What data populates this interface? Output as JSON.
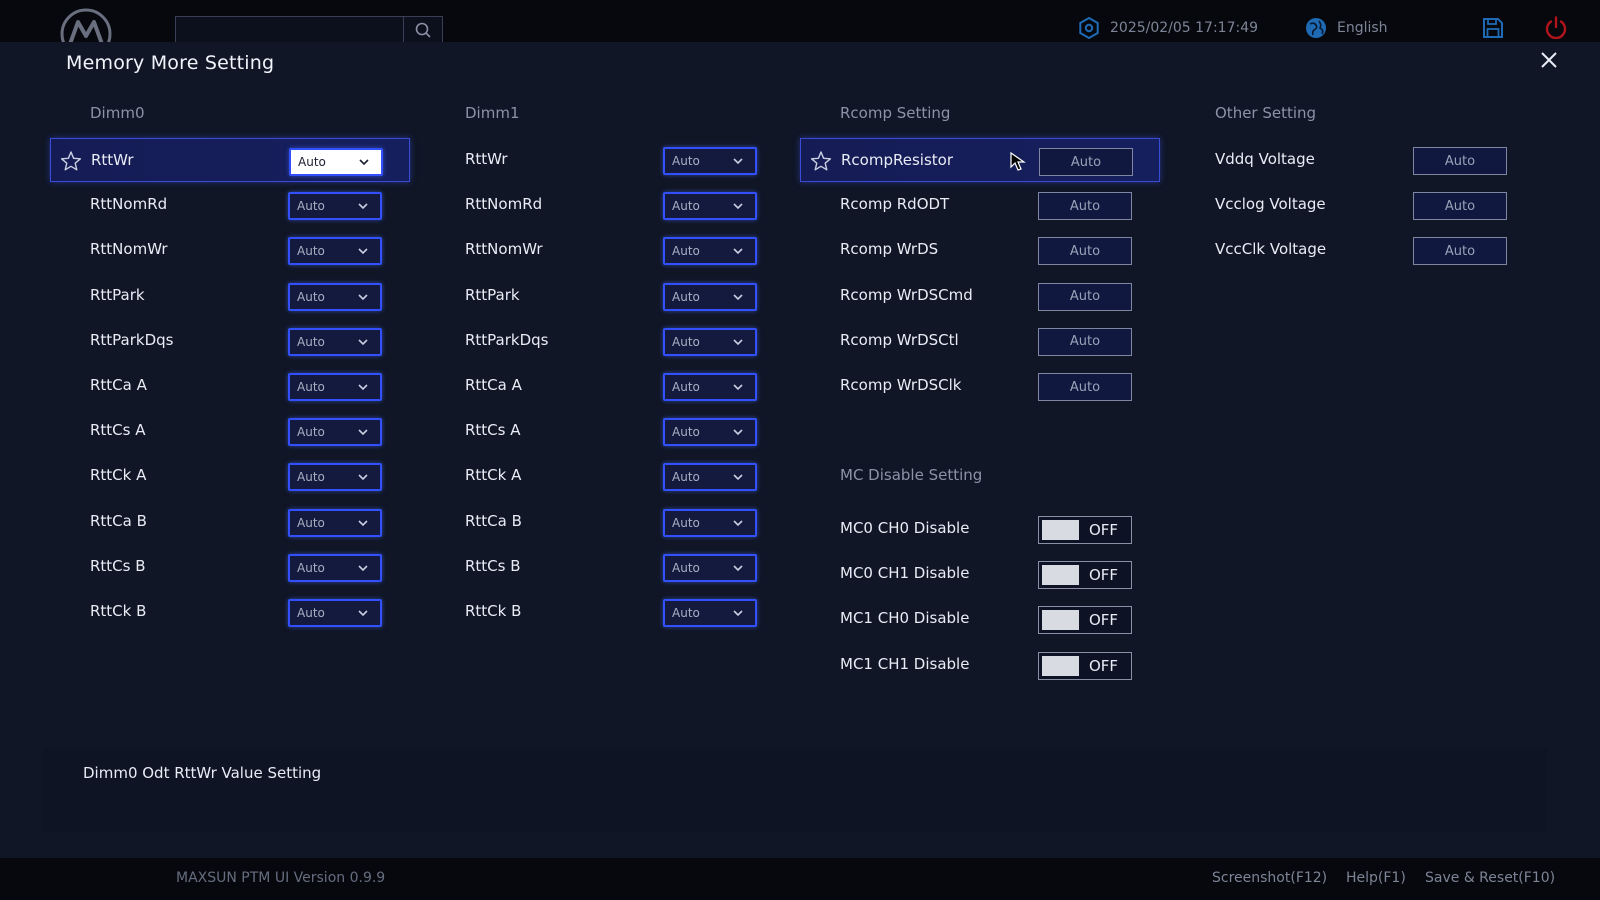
{
  "topbar": {
    "datetime": "2025/02/05 17:17:49",
    "language": "English",
    "search_placeholder": ""
  },
  "panel": {
    "title": "Memory More Setting"
  },
  "dimm0": {
    "header": "Dimm0",
    "rows": [
      {
        "label": "RttWr",
        "value": "Auto"
      },
      {
        "label": "RttNomRd",
        "value": "Auto"
      },
      {
        "label": "RttNomWr",
        "value": "Auto"
      },
      {
        "label": "RttPark",
        "value": "Auto"
      },
      {
        "label": "RttParkDqs",
        "value": "Auto"
      },
      {
        "label": "RttCa A",
        "value": "Auto"
      },
      {
        "label": "RttCs A",
        "value": "Auto"
      },
      {
        "label": "RttCk A",
        "value": "Auto"
      },
      {
        "label": "RttCa B",
        "value": "Auto"
      },
      {
        "label": "RttCs B",
        "value": "Auto"
      },
      {
        "label": "RttCk B",
        "value": "Auto"
      }
    ]
  },
  "dimm1": {
    "header": "Dimm1",
    "rows": [
      {
        "label": "RttWr",
        "value": "Auto"
      },
      {
        "label": "RttNomRd",
        "value": "Auto"
      },
      {
        "label": "RttNomWr",
        "value": "Auto"
      },
      {
        "label": "RttPark",
        "value": "Auto"
      },
      {
        "label": "RttParkDqs",
        "value": "Auto"
      },
      {
        "label": "RttCa A",
        "value": "Auto"
      },
      {
        "label": "RttCs A",
        "value": "Auto"
      },
      {
        "label": "RttCk A",
        "value": "Auto"
      },
      {
        "label": "RttCa B",
        "value": "Auto"
      },
      {
        "label": "RttCs B",
        "value": "Auto"
      },
      {
        "label": "RttCk B",
        "value": "Auto"
      }
    ]
  },
  "rcomp": {
    "header": "Rcomp Setting",
    "rows": [
      {
        "label": "RcompResistor",
        "value": "Auto"
      },
      {
        "label": "Rcomp RdODT",
        "value": "Auto"
      },
      {
        "label": "Rcomp WrDS",
        "value": "Auto"
      },
      {
        "label": "Rcomp WrDSCmd",
        "value": "Auto"
      },
      {
        "label": "Rcomp WrDSCtl",
        "value": "Auto"
      },
      {
        "label": "Rcomp WrDSClk",
        "value": "Auto"
      }
    ]
  },
  "mc_disable": {
    "header": "MC Disable Setting",
    "rows": [
      {
        "label": "MC0 CH0 Disable",
        "value": "OFF"
      },
      {
        "label": "MC0 CH1 Disable",
        "value": "OFF"
      },
      {
        "label": "MC1 CH0 Disable",
        "value": "OFF"
      },
      {
        "label": "MC1 CH1 Disable",
        "value": "OFF"
      }
    ]
  },
  "other": {
    "header": "Other Setting",
    "rows": [
      {
        "label": "Vddq Voltage",
        "value": "Auto"
      },
      {
        "label": "Vcclog Voltage",
        "value": "Auto"
      },
      {
        "label": "VccClk Voltage",
        "value": "Auto"
      }
    ]
  },
  "description": "Dimm0 Odt RttWr Value Setting",
  "footer": {
    "version": "MAXSUN PTM UI Version 0.9.9",
    "screenshot": "Screenshot(F12)",
    "help": "Help(F1)",
    "save_reset": "Save & Reset(F10)"
  },
  "colors": {
    "accent": "#3350ff",
    "selected_bg": "#151c55",
    "panel_bg": "#101626",
    "power_icon": "#b3141c",
    "top_icons": "#1e6ab5"
  }
}
